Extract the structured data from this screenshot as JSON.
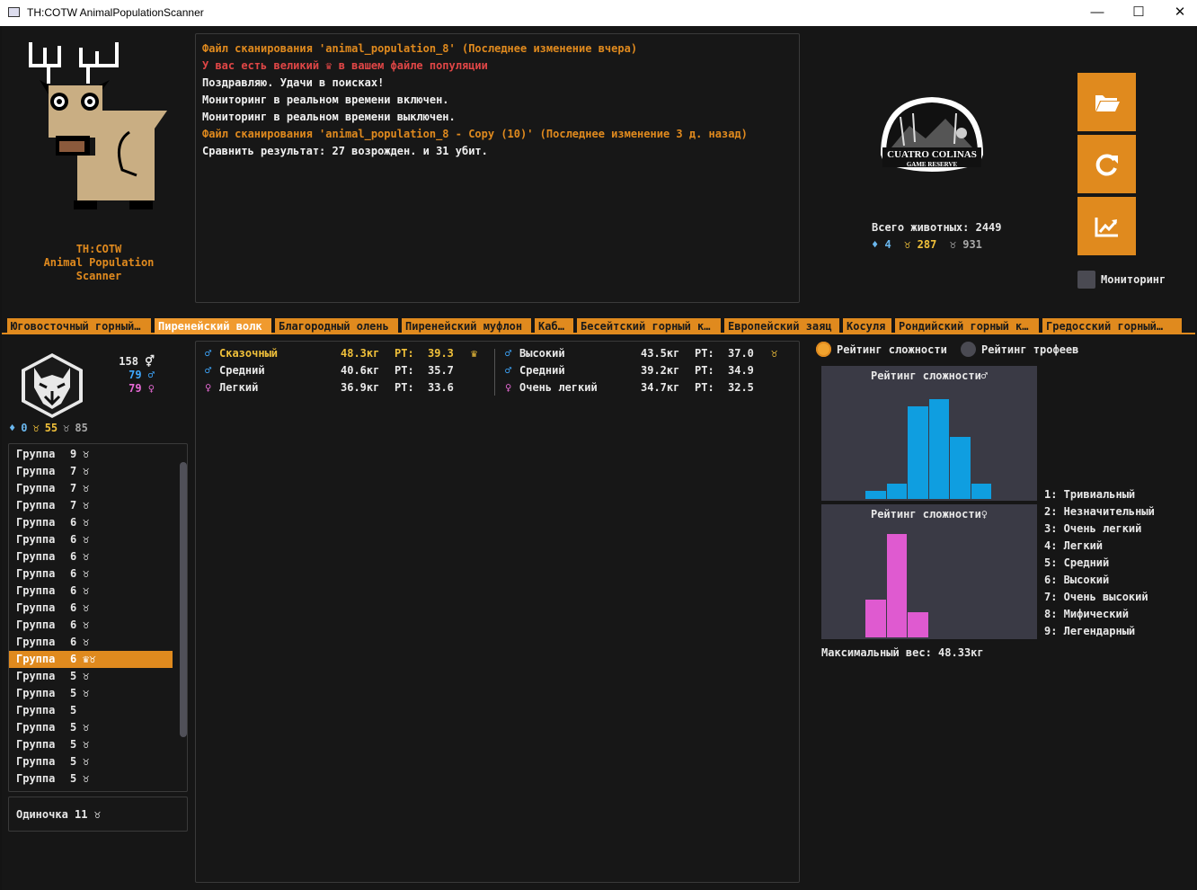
{
  "window": {
    "title": "TH:COTW AnimalPopulationScanner"
  },
  "app_name": [
    "TH:COTW",
    "Animal Population",
    "Scanner"
  ],
  "log": [
    {
      "text": "Файл сканирования 'animal_population_8' (Последнее изменение вчера)",
      "color": "orange"
    },
    {
      "text": "У вас есть великий ♛ в вашем файле популяции",
      "color": "red"
    },
    {
      "text": "Поздравляю. Удачи в поисках!",
      "color": "white"
    },
    {
      "text": "Мониторинг в реальном времени включен.",
      "color": "white"
    },
    {
      "text": "Мониторинг в реальном времени выключен.",
      "color": "white"
    },
    {
      "text": "Файл сканирования 'animal_population_8 - Copy (10)' (Последнее изменение 3 д. назад)",
      "color": "orange"
    },
    {
      "text": "Сравнить результат: 27 возрожден. и 31 убит.",
      "color": "white"
    }
  ],
  "reserve": {
    "line1": "CUATRO COLINAS",
    "line2": "GAME RESERVE"
  },
  "totals": {
    "label": "Всего животных: 2449",
    "diamond": "4",
    "gold": "287",
    "silver": "931"
  },
  "buttons": {
    "open": "folder-open-icon",
    "refresh": "refresh-icon",
    "stats": "chart-icon"
  },
  "monitoring": {
    "label": "Мониторинг",
    "checked": false
  },
  "tabs": [
    "Юговосточный горный…",
    "Пиренейский волк",
    "Благородный олень",
    "Пиренейский муфлон",
    "Кабан",
    "Бесейтский горный к…",
    "Европейский заяц",
    "Косуля",
    "Рондийский горный к…",
    "Гредосский горный…"
  ],
  "active_tab": 1,
  "species": {
    "total": "158 ⚥",
    "male": "79 ♂",
    "female": "79 ♀",
    "diamond": "0",
    "gold": "55",
    "silver": "85"
  },
  "groups": [
    {
      "label": "Группа",
      "n": "9",
      "icon": "♉"
    },
    {
      "label": "Группа",
      "n": "7",
      "icon": "♉"
    },
    {
      "label": "Группа",
      "n": "7",
      "icon": "♉"
    },
    {
      "label": "Группа",
      "n": "7",
      "icon": "♉"
    },
    {
      "label": "Группа",
      "n": "6",
      "icon": "♉"
    },
    {
      "label": "Группа",
      "n": "6",
      "icon": "♉"
    },
    {
      "label": "Группа",
      "n": "6",
      "icon": "♉"
    },
    {
      "label": "Группа",
      "n": "6",
      "icon": "♉"
    },
    {
      "label": "Группа",
      "n": "6",
      "icon": "♉"
    },
    {
      "label": "Группа",
      "n": "6",
      "icon": "♉"
    },
    {
      "label": "Группа",
      "n": "6",
      "icon": "♉"
    },
    {
      "label": "Группа",
      "n": "6",
      "icon": "♉"
    },
    {
      "label": "Группа",
      "n": "6",
      "icon": "♛♉"
    },
    {
      "label": "Группа",
      "n": "5",
      "icon": "♉"
    },
    {
      "label": "Группа",
      "n": "5",
      "icon": "♉"
    },
    {
      "label": "Группа",
      "n": "5",
      "icon": ""
    },
    {
      "label": "Группа",
      "n": "5",
      "icon": "♉"
    },
    {
      "label": "Группа",
      "n": "5",
      "icon": "♉"
    },
    {
      "label": "Группа",
      "n": "5",
      "icon": "♉"
    },
    {
      "label": "Группа",
      "n": "5",
      "icon": "♉"
    }
  ],
  "selected_group": 12,
  "single": {
    "label": "Одиночка",
    "n": "11",
    "icon": "♉"
  },
  "animals_left": [
    {
      "sex": "♂",
      "rating": "Сказочный",
      "weight": "48.3кг",
      "rt": "РТ:",
      "score": "39.3",
      "badge": "♛",
      "highlight": true
    },
    {
      "sex": "♂",
      "rating": "Средний",
      "weight": "40.6кг",
      "rt": "РТ:",
      "score": "35.7",
      "badge": ""
    },
    {
      "sex": "♀",
      "rating": "Легкий",
      "weight": "36.9кг",
      "rt": "РТ:",
      "score": "33.6",
      "badge": ""
    }
  ],
  "animals_right": [
    {
      "sex": "♂",
      "rating": "Высокий",
      "weight": "43.5кг",
      "rt": "РТ:",
      "score": "37.0",
      "badge": "♉"
    },
    {
      "sex": "♂",
      "rating": "Средний",
      "weight": "39.2кг",
      "rt": "РТ:",
      "score": "34.9",
      "badge": ""
    },
    {
      "sex": "♀",
      "rating": "Очень легкий",
      "weight": "34.7кг",
      "rt": "РТ:",
      "score": "32.5",
      "badge": ""
    }
  ],
  "radio": {
    "difficulty": "Рейтинг сложности",
    "trophy": "Рейтинг трофеев",
    "selected": "difficulty"
  },
  "chart_data": [
    {
      "type": "bar",
      "title": "Рейтинг сложности♂",
      "categories": [
        1,
        2,
        3,
        4,
        5,
        6,
        7,
        8,
        9
      ],
      "values": [
        0,
        0,
        1,
        2,
        12,
        13,
        8,
        2,
        0
      ],
      "color": "#0f9ee0",
      "ylim": [
        0,
        14
      ]
    },
    {
      "type": "bar",
      "title": "Рейтинг сложности♀",
      "categories": [
        1,
        2,
        3,
        4,
        5,
        6,
        7,
        8,
        9
      ],
      "values": [
        0,
        0,
        9,
        25,
        6,
        0,
        0,
        0,
        0
      ],
      "color": "#df5ad0",
      "ylim": [
        0,
        26
      ]
    }
  ],
  "legend": [
    "1: Тривиальный",
    "2: Незначительный",
    "3: Очень легкий",
    "4: Легкий",
    "5: Средний",
    "6: Высокий",
    "7: Очень высокий",
    "8: Мифический",
    "9: Легендарный"
  ],
  "max_weight": "Максимальный вес: 48.33кг"
}
